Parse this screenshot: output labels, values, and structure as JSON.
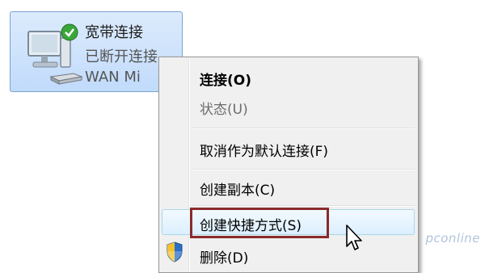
{
  "connection": {
    "name": "宽带连接",
    "status": "已断开连接",
    "device": "WAN Mi"
  },
  "context_menu": {
    "items": [
      {
        "label": "连接(O)",
        "style": "bold"
      },
      {
        "label": "状态(U)",
        "style": "disabled"
      },
      {
        "label": "取消作为默认连接(F)",
        "style": "normal"
      },
      {
        "label": "创建副本(C)",
        "style": "normal"
      },
      {
        "label": "创建快捷方式(S)",
        "style": "hovered"
      },
      {
        "label": "删除(D)",
        "style": "normal",
        "icon": "uac-shield-icon"
      }
    ]
  },
  "watermark": "pconline"
}
